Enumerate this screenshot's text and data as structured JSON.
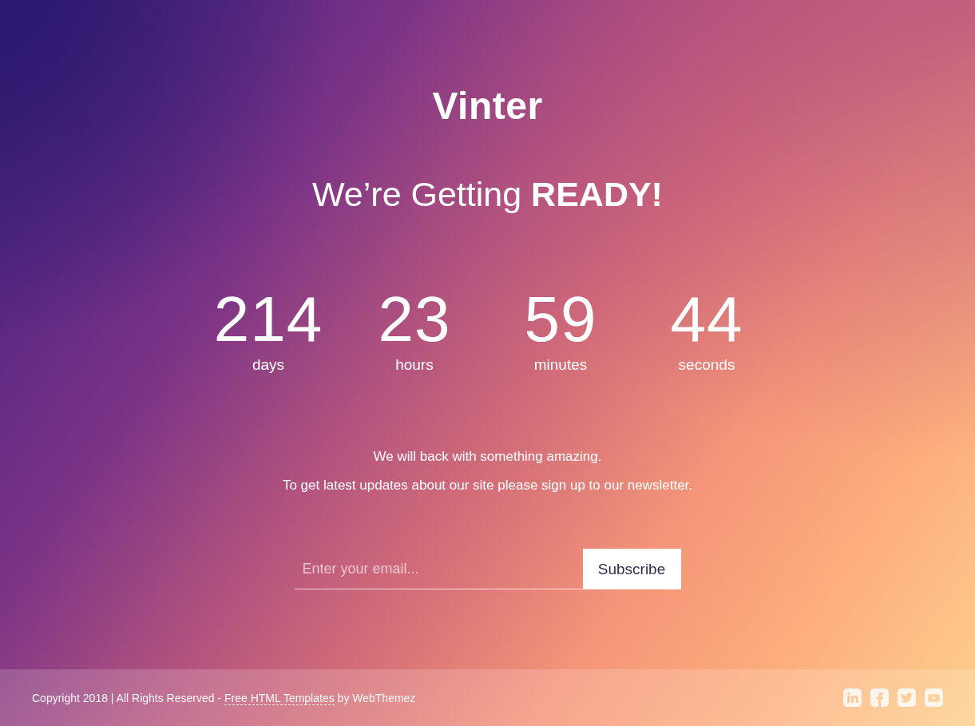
{
  "brand": {
    "logo": "Vinter"
  },
  "headline": "We’re Getting **READY!**",
  "countdown": [
    {
      "value": "214",
      "unit": "days"
    },
    {
      "value": "23",
      "unit": "hours"
    },
    {
      "value": "59",
      "unit": "minutes"
    },
    {
      "value": "44",
      "unit": "seconds"
    }
  ],
  "message": [
    "We will back with something amazing.",
    "To get latest updates about our site please sign up to our newsletter."
  ],
  "newsletter": {
    "placeholder": "Enter your email...",
    "button": "Subscribe"
  },
  "footer": {
    "copyright": "Copyright 2018 | All Rights Reserved - ",
    "link": "Free HTML Templates",
    "suffix": " by WebThemez",
    "social": [
      {
        "kind": "linkedin"
      },
      {
        "kind": "facebook"
      },
      {
        "kind": "twitter"
      },
      {
        "kind": "video"
      }
    ]
  }
}
